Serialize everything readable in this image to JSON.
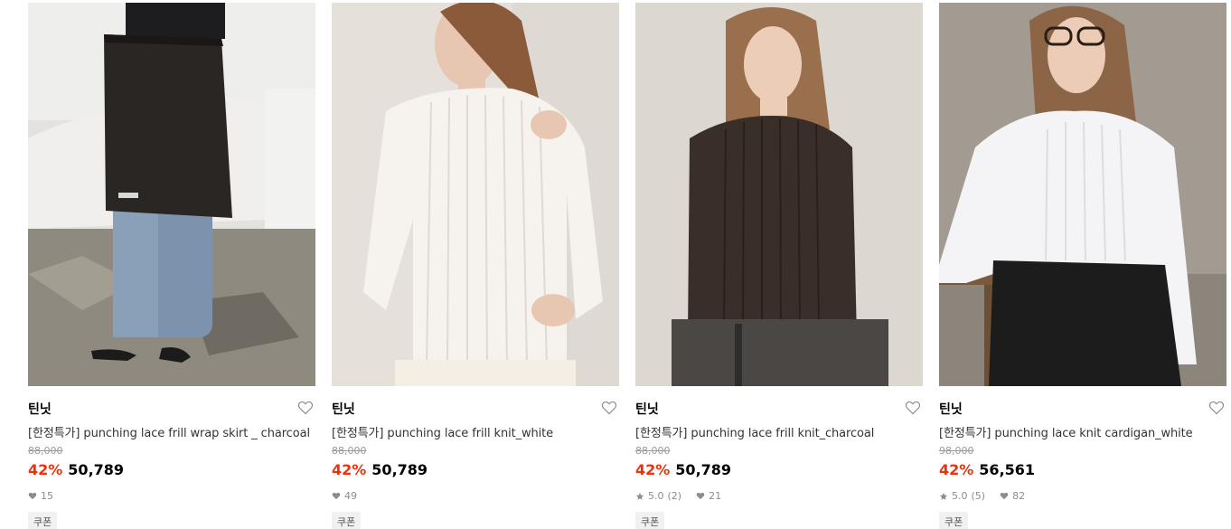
{
  "products": [
    {
      "brand": "틴닛",
      "name": "[한정특가] punching lace frill wrap skirt _ charcoal",
      "original_price": "88,000",
      "discount": "42%",
      "price": "50,789",
      "rating": "",
      "review_count": "",
      "likes": "15",
      "coupon_label": "쿠폰",
      "image_alt": "model wearing charcoal wrap skirt over jeans"
    },
    {
      "brand": "틴닛",
      "name": "[한정특가] punching lace frill knit_white",
      "original_price": "88,000",
      "discount": "42%",
      "price": "50,789",
      "rating": "",
      "review_count": "",
      "likes": "49",
      "coupon_label": "쿠폰",
      "image_alt": "model wearing white lace knit top"
    },
    {
      "brand": "틴닛",
      "name": "[한정특가] punching lace frill knit_charcoal",
      "original_price": "88,000",
      "discount": "42%",
      "price": "50,789",
      "rating": "5.0",
      "review_count": "(2)",
      "likes": "21",
      "coupon_label": "쿠폰",
      "image_alt": "model wearing charcoal lace knit top"
    },
    {
      "brand": "틴닛",
      "name": "[한정특가] punching lace knit cardigan_white",
      "original_price": "98,000",
      "discount": "42%",
      "price": "56,561",
      "rating": "5.0",
      "review_count": "(5)",
      "likes": "82",
      "coupon_label": "쿠폰",
      "image_alt": "model wearing white lace cardigan and black skirt"
    }
  ],
  "colors": {
    "discount": "#e8330d",
    "price": "#000000",
    "meta": "#8c8c8c"
  }
}
